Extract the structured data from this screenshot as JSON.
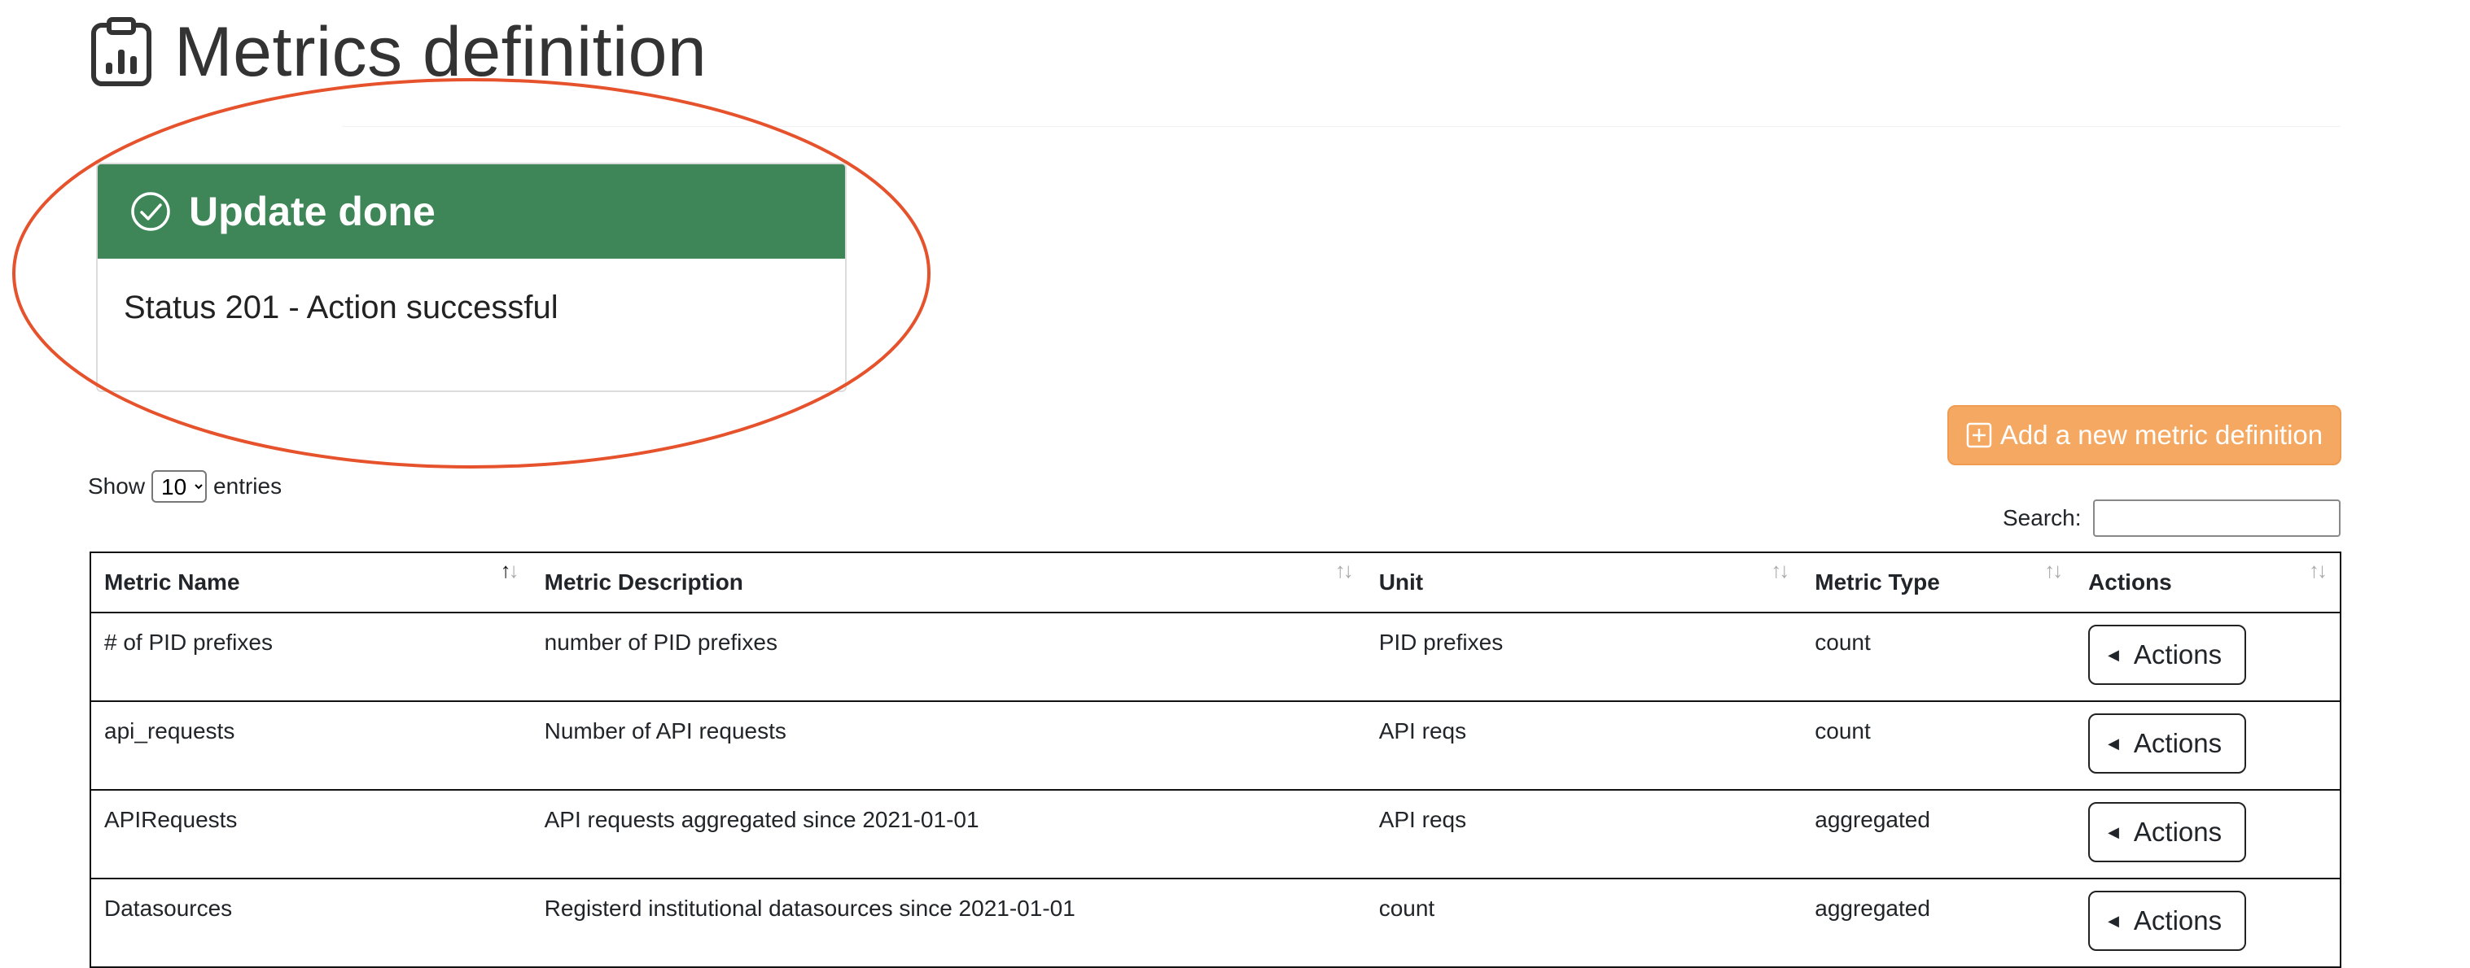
{
  "page": {
    "title": "Metrics definition",
    "title_icon": "clipboard-data-icon"
  },
  "toast": {
    "title": "Update done",
    "icon": "check-circle-icon",
    "message": "Status 201 - Action successful",
    "header_color": "#3e8657"
  },
  "callout_color": "#e5522c",
  "toolbar": {
    "add_label": "Add a new metric definition",
    "add_color": "#f5a861"
  },
  "length": {
    "prefix": "Show",
    "value": "10",
    "suffix": "entries"
  },
  "search": {
    "label": "Search:",
    "value": ""
  },
  "table": {
    "columns": [
      "Metric Name",
      "Metric Description",
      "Unit",
      "Metric Type",
      "Actions"
    ],
    "sorted_column": "Metric Name",
    "rows": [
      {
        "name": "# of PID prefixes",
        "description": "number of PID prefixes",
        "unit": "PID prefixes",
        "type": "count",
        "action": "Actions"
      },
      {
        "name": "api_requests",
        "description": "Number of API requests",
        "unit": "API reqs",
        "type": "count",
        "action": "Actions"
      },
      {
        "name": "APIRequests",
        "description": "API requests aggregated since 2021-01-01",
        "unit": "API reqs",
        "type": "aggregated",
        "action": "Actions"
      },
      {
        "name": "Datasources",
        "description": "Registerd institutional datasources since 2021-01-01",
        "unit": "count",
        "type": "aggregated",
        "action": "Actions"
      }
    ]
  }
}
